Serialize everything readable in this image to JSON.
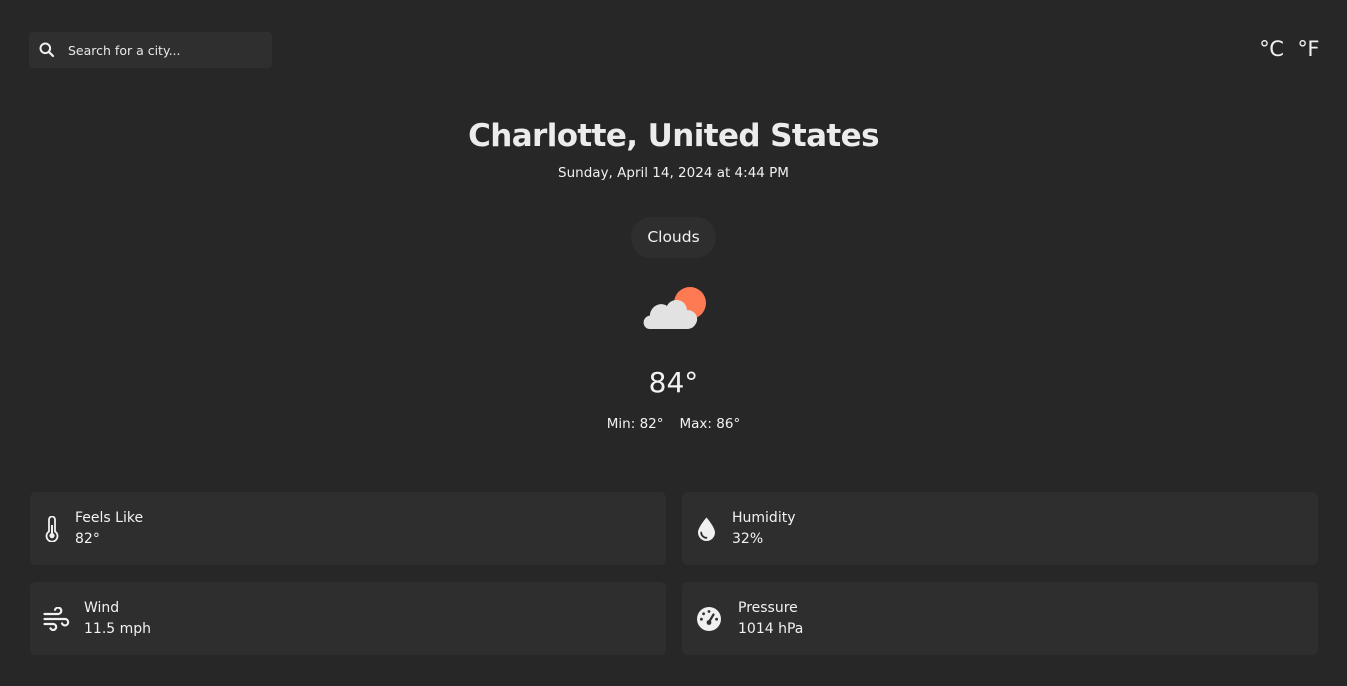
{
  "search": {
    "placeholder": "Search for a city...",
    "icon": "search-icon"
  },
  "units": {
    "celsius_label": "°C",
    "fahrenheit_label": "°F"
  },
  "location": {
    "city": "Charlotte, United States",
    "datetime": "Sunday, April 14, 2024 at 4:44 PM"
  },
  "weather": {
    "condition": "Clouds",
    "icon": "partly-cloudy-icon",
    "temperature": "84°",
    "min": "Min: 82°",
    "max": "Max: 86°"
  },
  "details": {
    "feels_like": {
      "label": "Feels Like",
      "value": "82°",
      "icon": "thermometer-icon"
    },
    "humidity": {
      "label": "Humidity",
      "value": "32%",
      "icon": "droplet-icon"
    },
    "wind": {
      "label": "Wind",
      "value": "11.5 mph",
      "icon": "wind-icon"
    },
    "pressure": {
      "label": "Pressure",
      "value": "1014 hPa",
      "icon": "gauge-icon"
    }
  },
  "colors": {
    "background": "#272727",
    "card": "#2e2e2e",
    "text": "#f2f2f2",
    "sun": "#fd7a52",
    "cloud": "#e2e2e2"
  }
}
